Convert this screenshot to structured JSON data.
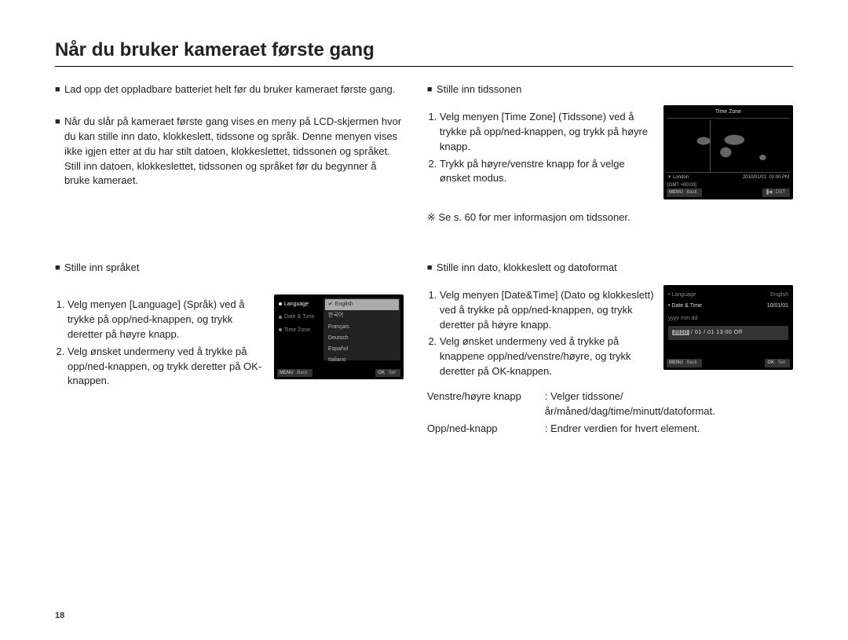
{
  "title": "Når du bruker kameraet første gang",
  "page_number": "18",
  "intro": {
    "p1": "Lad opp det oppladbare batteriet helt før du bruker kameraet første gang.",
    "p2": "Når du slår på kameraet første gang vises en meny på LCD-skjermen hvor du kan stille inn dato, klokkeslett, tidssone og språk. Denne menyen vises ikke igjen etter at du har stilt datoen, klokkeslettet, tidssonen og språket. Still inn datoen, klokkeslettet, tidssonen og språket før du begynner å bruke kameraet."
  },
  "lang_section": {
    "heading": "Stille inn språket",
    "step1": "Velg menyen [Language] (Språk) ved å trykke på opp/ned-knappen, og trykk deretter på høyre knapp.",
    "step2": "Velg ønsket undermeny ved å trykke på opp/ned-knappen, og trykk deretter på OK-knappen."
  },
  "tz_section": {
    "heading": "Stille inn tidssonen",
    "step1": "Velg menyen [Time Zone] (Tidssone) ved å trykke på opp/ned-knappen, og trykk på høyre knapp.",
    "step2": "Trykk på høyre/venstre knapp for å velge ønsket modus.",
    "note": "※ Se s. 60 for mer informasjon om tidssoner."
  },
  "dt_section": {
    "heading": "Stille inn dato, klokkeslett og datoformat",
    "step1": "Velg menyen [Date&Time] (Dato og klokkeslett) ved å trykke på opp/ned-knappen, og trykk deretter på høyre knapp.",
    "step2": "Velg ønsket undermeny ved å trykke på knappene opp/ned/venstre/høyre, og trykk deretter på OK-knappen.",
    "kv1_label": "Venstre/høyre knapp",
    "kv1_value": ": Velger tidssone/år/måned/dag/time/minutt/datoformat.",
    "kv2_label": "Opp/ned-knapp",
    "kv2_value": ": Endrer verdien for hvert element."
  },
  "screen_lang": {
    "menu_language": "Language",
    "menu_datetime": "Date & Time",
    "menu_timezone": "Time Zone",
    "options": [
      "English",
      "한국어",
      "Français",
      "Deutsch",
      "Español",
      "Italiano"
    ],
    "footer_back": "Back",
    "footer_set": "Set",
    "footer_back_btn": "MENU",
    "footer_set_btn": "OK"
  },
  "screen_tz": {
    "title": "Time Zone",
    "city": "London",
    "gmt": "[GMT +00:00]",
    "date": "2010/01/01",
    "time": "01:00 PM",
    "footer_back_btn": "MENU",
    "footer_back": "Back",
    "footer_dst_btn": "▐◀",
    "footer_dst": "DST"
  },
  "screen_dt": {
    "row1_left": "Language",
    "row1_right": "English",
    "row2_left": "Date & Time",
    "row2_right": "10/01/01",
    "fmt": "yyyy mm dd",
    "field_hl": "2010",
    "field_rest": " / 01 / 01   13:00   Off",
    "footer_back_btn": "MENU",
    "footer_back": "Back",
    "footer_set_btn": "OK",
    "footer_set": "Set"
  }
}
